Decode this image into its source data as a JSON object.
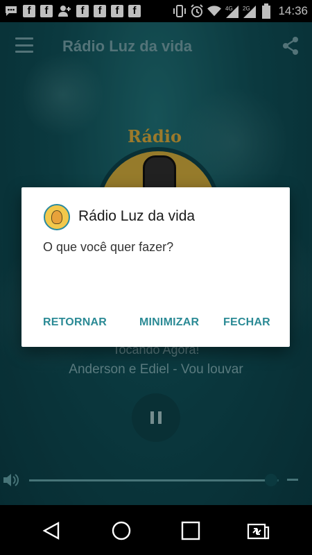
{
  "status_bar": {
    "time": "14:36",
    "left_icons": [
      "chat-icon",
      "facebook-icon",
      "facebook-icon",
      "add-contact-icon",
      "facebook-icon",
      "facebook-icon",
      "facebook-icon",
      "facebook-icon"
    ],
    "right_icons": [
      "vibrate-icon",
      "alarm-icon",
      "wifi-icon",
      "signal-4g-icon",
      "signal-2g-icon",
      "battery-icon"
    ],
    "fb_glyph": "f",
    "signal_4g_label": "4G",
    "signal_2g_label": "2G"
  },
  "app": {
    "title": "Rádio Luz da vida",
    "logo_text": "Rádio",
    "now_playing_label": "Tocando Agora!",
    "track": "Anderson e Ediel - Vou louvar",
    "volume_fraction": 0.97
  },
  "dialog": {
    "title": "Rádio Luz da vida",
    "message": "O que você quer fazer?",
    "buttons": {
      "retornar": "RETORNAR",
      "minimizar": "MINIMIZAR",
      "fechar": "FECHAR"
    }
  },
  "colors": {
    "accent": "#2b8a95",
    "app_background": "#0f4d55"
  }
}
